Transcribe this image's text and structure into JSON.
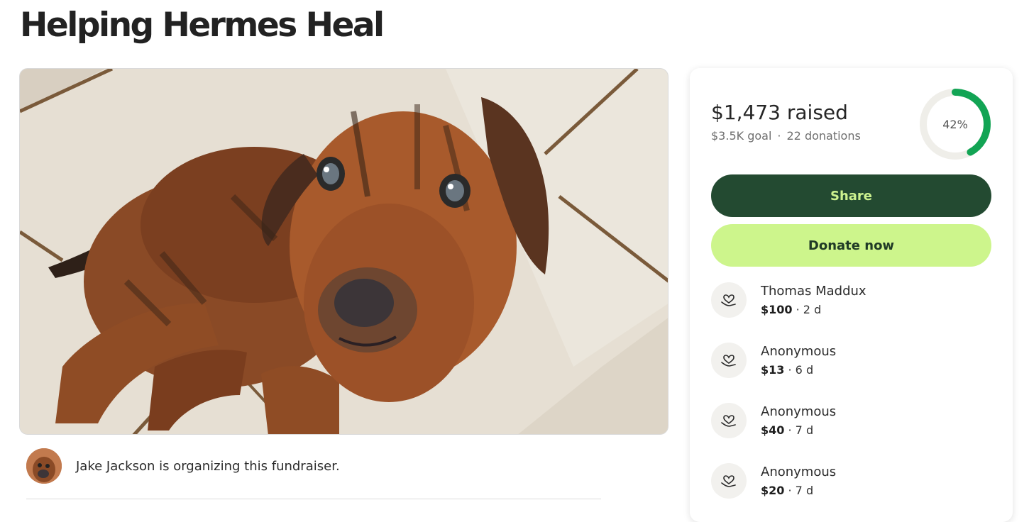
{
  "campaign": {
    "title": "Helping Hermes Heal",
    "organizer_text": "Jake Jackson is organizing this fundraiser."
  },
  "progress": {
    "raised_text": "$1,473 raised",
    "goal_text": "$3.5K goal",
    "donations_text": "22 donations",
    "separator": "·",
    "percent_label": "42%",
    "percent": 42,
    "accent_color": "#12a454",
    "track_color": "#efeee9"
  },
  "actions": {
    "share_label": "Share",
    "donate_label": "Donate now"
  },
  "donations": [
    {
      "name": "Thomas Maddux",
      "amount": "$100",
      "time": "· 2 d"
    },
    {
      "name": "Anonymous",
      "amount": "$13",
      "time": "· 6 d"
    },
    {
      "name": "Anonymous",
      "amount": "$40",
      "time": "· 7 d"
    },
    {
      "name": "Anonymous",
      "amount": "$20",
      "time": "· 7 d"
    }
  ],
  "colors": {
    "share_bg": "#234a31",
    "share_text": "#cdf28f",
    "donate_bg": "#cdf58c",
    "donate_text": "#1f3a26"
  },
  "icons": {
    "donation": "heart-in-hand-icon"
  }
}
